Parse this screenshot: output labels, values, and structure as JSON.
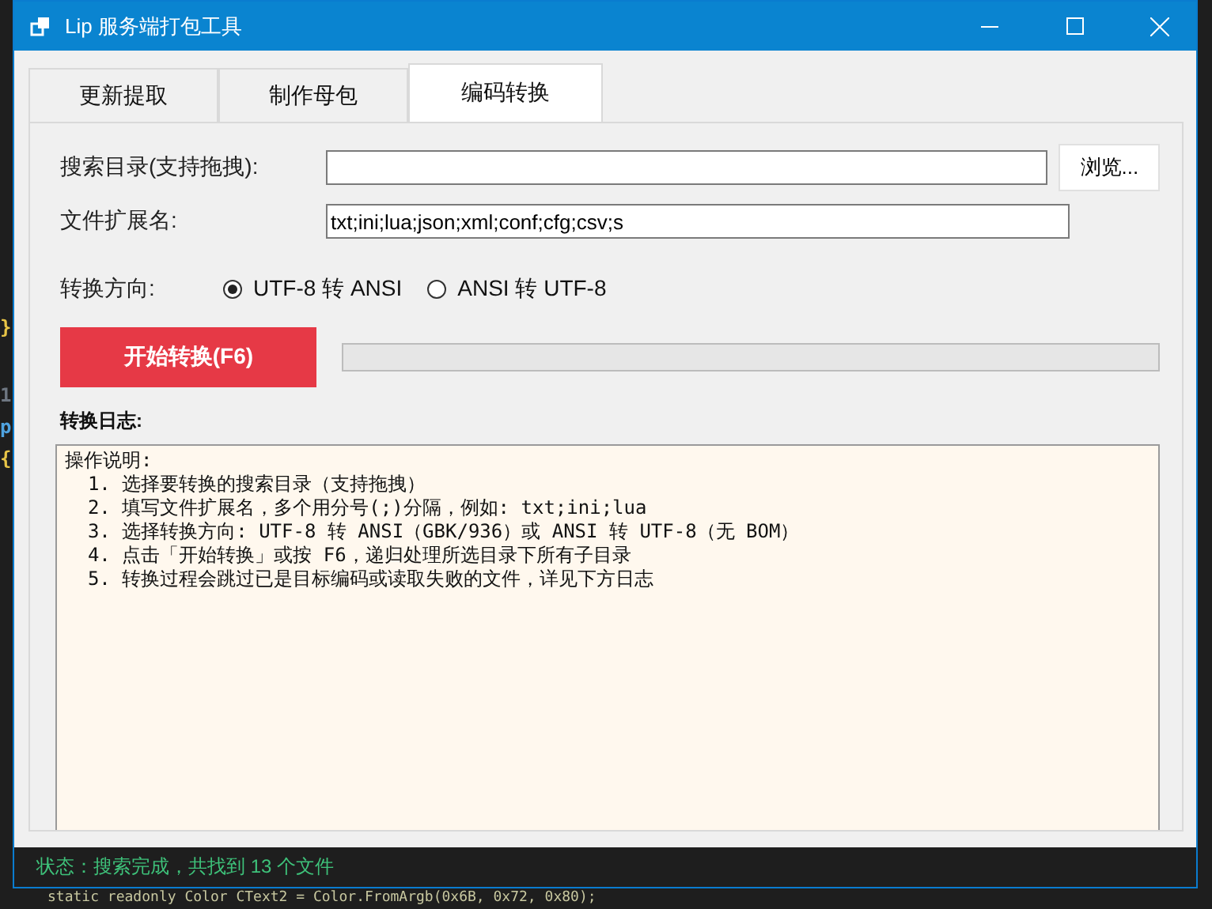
{
  "background_editor": {
    "fragments": [
      {
        "text": "}",
        "color": "#e8c547"
      },
      {
        "text": "1",
        "color": "#6e7681"
      },
      {
        "text": "p",
        "color": "#4fa3e0"
      },
      {
        "text": "{",
        "color": "#e8c547"
      }
    ],
    "code_line": "static readonly Color CText2 = Color.FromArgb(0x6B, 0x72, 0x80);"
  },
  "window": {
    "title": "Lip 服务端打包工具"
  },
  "tabs": [
    {
      "label": "更新提取",
      "selected": false
    },
    {
      "label": "制作母包",
      "selected": false
    },
    {
      "label": "编码转换",
      "selected": true
    }
  ],
  "form": {
    "search_dir": {
      "label": "搜索目录(支持拖拽):",
      "button": "浏览..."
    },
    "extensions": {
      "label": "文件扩展名:",
      "value": "txt;ini;lua;json;xml;conf;cfg;csv;s"
    },
    "direction": {
      "label": "转换方向:",
      "options": [
        {
          "label": "UTF-8 转 ANSI",
          "selected": true
        },
        {
          "label": "ANSI 转 UTF-8",
          "selected": false
        }
      ]
    },
    "start_button": "开始转换(F6)",
    "progress": {
      "level": 0
    }
  },
  "log": {
    "label": "转换日志:",
    "lines": [
      "操作说明:",
      "  1. 选择要转换的搜索目录（支持拖拽）",
      "  2. 填写文件扩展名，多个用分号(;)分隔，例如: txt;ini;lua",
      "  3. 选择转换方向: UTF-8 转 ANSI（GBK/936）或 ANSI 转 UTF-8（无 BOM）",
      "  4. 点击「开始转换」或按 F6，递归处理所选目录下所有子目录",
      "  5. 转换过程会跳过已是目标编码或读取失败的文件，详见下方日志"
    ]
  },
  "status_bar": "状态：搜索完成，共找到 13 个文件"
}
